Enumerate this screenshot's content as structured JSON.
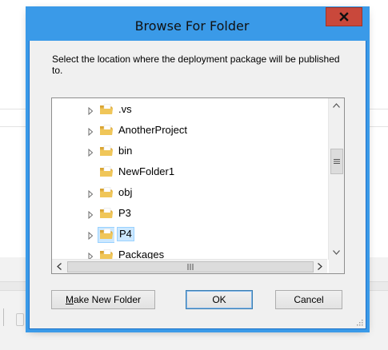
{
  "dialog": {
    "title": "Browse For Folder",
    "close_glyph": "x",
    "description": "Select the location where the deployment package will be published to."
  },
  "tree": {
    "items": [
      {
        "label": ".vs",
        "expandable": true,
        "selected": false
      },
      {
        "label": "AnotherProject",
        "expandable": true,
        "selected": false
      },
      {
        "label": "bin",
        "expandable": true,
        "selected": false
      },
      {
        "label": "NewFolder1",
        "expandable": false,
        "selected": false
      },
      {
        "label": "obj",
        "expandable": true,
        "selected": false
      },
      {
        "label": "P3",
        "expandable": true,
        "selected": false
      },
      {
        "label": "P4",
        "expandable": true,
        "selected": true
      },
      {
        "label": "Packages",
        "expandable": true,
        "selected": false
      }
    ]
  },
  "buttons": {
    "make_new_folder": "Make New Folder",
    "ok": "OK",
    "cancel": "Cancel"
  },
  "icons": {
    "folder": "folder-icon",
    "expand": "expand-arrow-icon",
    "close": "close-icon"
  },
  "colors": {
    "title_bar": "#3a9ae8",
    "close_button": "#c9483b",
    "selection": "#cce8ff",
    "folder": "#e8b84a"
  }
}
